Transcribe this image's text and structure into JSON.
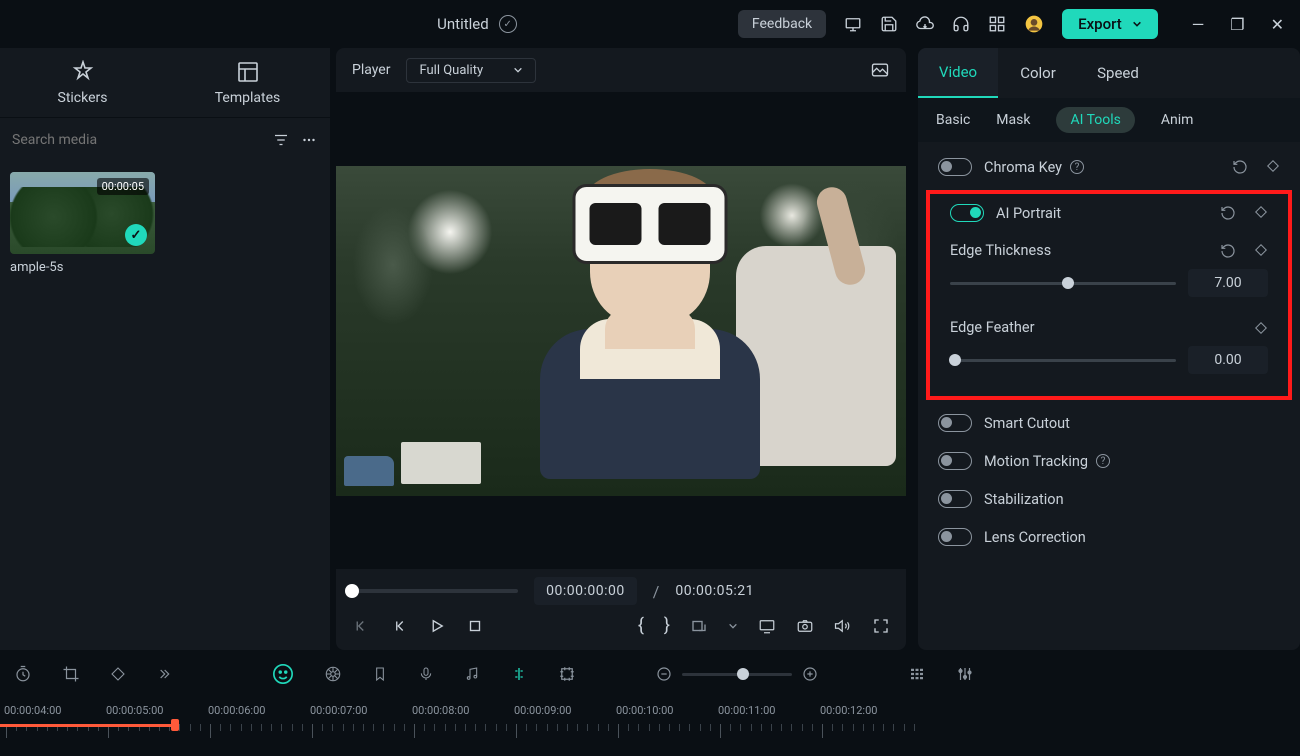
{
  "titlebar": {
    "title": "Untitled",
    "feedback": "Feedback",
    "export": "Export"
  },
  "left": {
    "tab_stickers": "Stickers",
    "tab_templates": "Templates",
    "search_placeholder": "Search media",
    "thumb_duration": "00:00:05",
    "thumb_label": "ample-5s"
  },
  "player": {
    "label": "Player",
    "quality": "Full Quality",
    "time_current": "00:00:00:00",
    "time_total": "00:00:05:21"
  },
  "right": {
    "tabs": {
      "video": "Video",
      "color": "Color",
      "speed": "Speed"
    },
    "subtabs": {
      "basic": "Basic",
      "mask": "Mask",
      "ai_tools": "AI Tools",
      "anim": "Anim"
    },
    "chroma_key": "Chroma Key",
    "ai_portrait": "AI Portrait",
    "edge_thickness": "Edge Thickness",
    "edge_thickness_val": "7.00",
    "edge_feather": "Edge Feather",
    "edge_feather_val": "0.00",
    "smart_cutout": "Smart Cutout",
    "motion_tracking": "Motion Tracking",
    "stabilization": "Stabilization",
    "lens_correction": "Lens Correction"
  },
  "timeline": {
    "labels": [
      "00:00:04:00",
      "00:00:05:00",
      "00:00:06:00",
      "00:00:07:00",
      "00:00:08:00",
      "00:00:09:00",
      "00:00:10:00",
      "00:00:11:00",
      "00:00:12:00"
    ]
  }
}
